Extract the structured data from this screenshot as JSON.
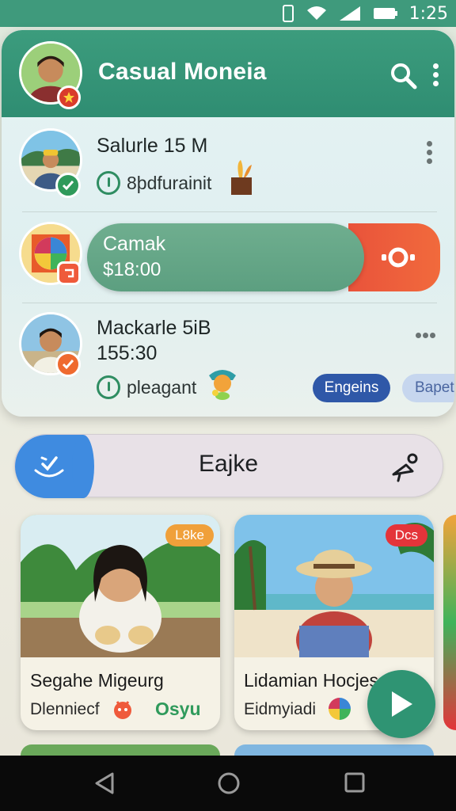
{
  "status_bar": {
    "time": "1:25"
  },
  "app_bar": {
    "title": "Casual Moneia",
    "avatar_badge_icon": "star-icon"
  },
  "list": [
    {
      "title": "Salurle 15 M",
      "subtitle": "8þdfurainit",
      "status_icon": "check-icon",
      "status_color": "#2f9a5b"
    },
    {
      "title": "Camak",
      "subtitle": "$18:00",
      "action_icon": "record-icon"
    },
    {
      "title": "Mackarle 5iB",
      "subtitle": "155:30",
      "extra": "pleagant",
      "chips": [
        "Engeins",
        "Bapet"
      ]
    }
  ],
  "search": {
    "label": "Eajke"
  },
  "tiles": [
    {
      "title": "Segahe Migeurg",
      "subtitle": "Dlenniecf",
      "tag": "L8ke",
      "brand": "Osyu",
      "tag_color": "#f0a03a"
    },
    {
      "title": "Lidamian Hocjes",
      "subtitle": "Eidmyiadi",
      "tag": "Dcs",
      "tag_color": "#e4343a"
    }
  ],
  "colors": {
    "primary": "#3c9c7d",
    "accent_red": "#ef5a3b",
    "accent_blue": "#3f8be0"
  }
}
